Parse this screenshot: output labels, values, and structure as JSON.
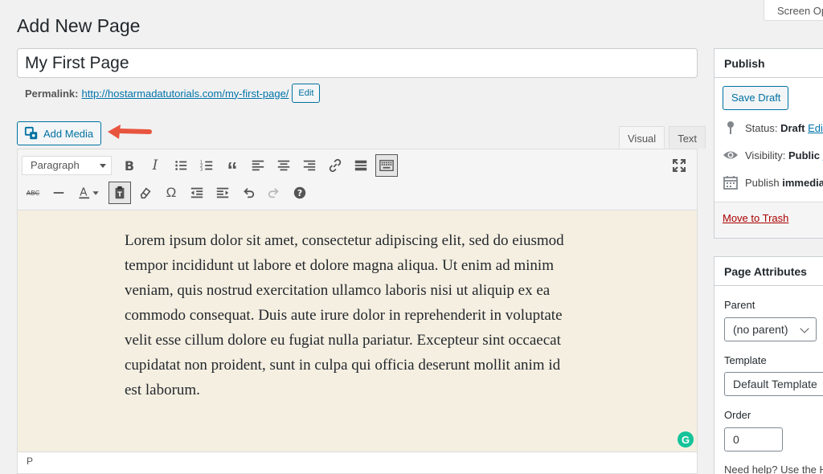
{
  "screen_options": "Screen Op",
  "heading": "Add New Page",
  "title_value": "My First Page",
  "permalink": {
    "label": "Permalink:",
    "url": "http://hostarmadatutorials.com/my-first-page/",
    "edit_label": "Edit"
  },
  "add_media_label": "Add Media",
  "tabs": {
    "visual": "Visual",
    "text": "Text"
  },
  "format_select": "Paragraph",
  "content": "Lorem ipsum dolor sit amet, consectetur adipiscing elit, sed do eiusmod tempor incididunt ut labore et dolore magna aliqua. Ut enim ad minim veniam, quis nostrud exercitation ullamco laboris nisi ut aliquip ex ea commodo consequat. Duis aute irure dolor in reprehenderit in voluptate velit esse cillum dolore eu fugiat nulla pariatur. Excepteur sint occaecat cupidatat non proident, sunt in culpa qui officia deserunt mollit anim id est laborum.",
  "status_path": "P",
  "grammarly_letter": "G",
  "publish": {
    "title": "Publish",
    "save_draft": "Save Draft",
    "status_label": "Status:",
    "status_value": "Draft",
    "status_edit": "Edit",
    "visibility_label": "Visibility:",
    "visibility_value": "Public",
    "visibility_edit": "E",
    "publish_label": "Publish",
    "publish_value": "immediat",
    "trash": "Move to Trash"
  },
  "attributes": {
    "title": "Page Attributes",
    "parent_label": "Parent",
    "parent_value": "(no parent)",
    "template_label": "Template",
    "template_value": "Default Template",
    "order_label": "Order",
    "order_value": "0",
    "help": "Need help? Use the H"
  },
  "colors": {
    "accent": "#0071a1",
    "editor_bg": "#f5efe1",
    "arrow": "#e8553e",
    "trash": "#aa0000",
    "grammarly": "#15c39a"
  }
}
